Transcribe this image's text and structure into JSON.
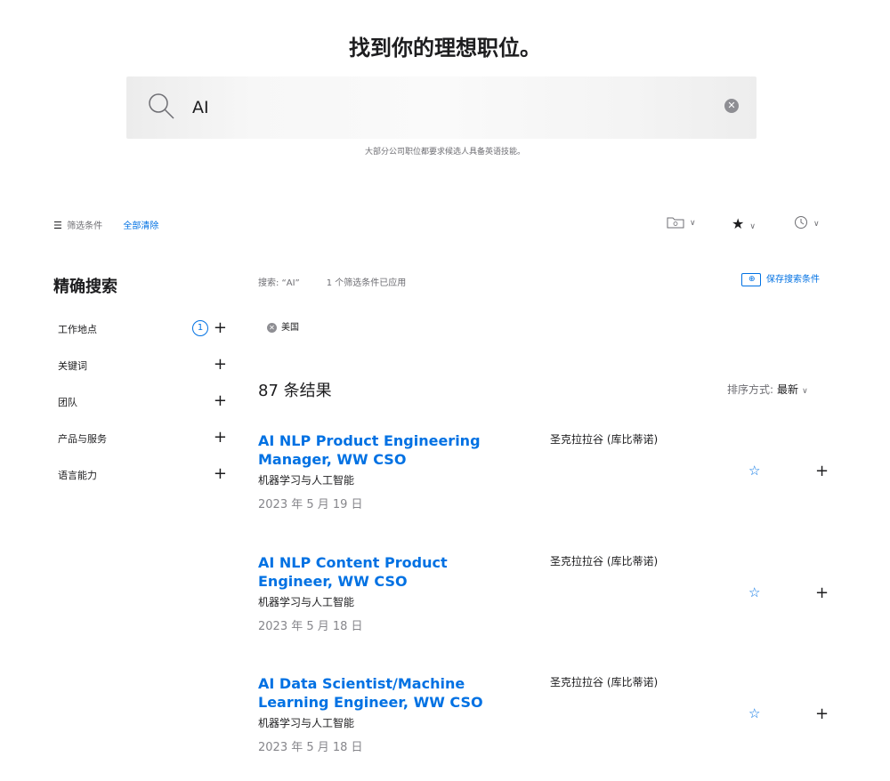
{
  "header": {
    "title": "找到你的理想职位。"
  },
  "search": {
    "value": "AI",
    "note": "大部分公司职位都要求候选人具备英语技能。"
  },
  "filter_bar": {
    "label": "筛选条件",
    "clear_all": "全部清除"
  },
  "sidebar": {
    "title": "精确搜索",
    "items": [
      {
        "label": "工作地点",
        "count": "1"
      },
      {
        "label": "关键词"
      },
      {
        "label": "团队"
      },
      {
        "label": "产品与服务"
      },
      {
        "label": "语言能力"
      }
    ]
  },
  "query": {
    "text": "搜索: “AI”",
    "applied": "1 个筛选条件已应用"
  },
  "save_search": {
    "label": "保存搜索条件"
  },
  "chip": {
    "label": "美国"
  },
  "results": {
    "count_label": "87 条结果"
  },
  "sort": {
    "label": "排序方式:",
    "value": "最新"
  },
  "jobs": [
    {
      "title": "AI NLP Product Engineering Manager, WW CSO",
      "location": "圣克拉拉谷 (库比蒂诺)",
      "team": "机器学习与人工智能",
      "date": "2023 年 5 月 19 日"
    },
    {
      "title": "AI NLP Content Product Engineer, WW CSO",
      "location": "圣克拉拉谷 (库比蒂诺)",
      "team": "机器学习与人工智能",
      "date": "2023 年 5 月 18 日"
    },
    {
      "title": "AI Data Scientist/Machine Learning Engineer, WW CSO",
      "location": "圣克拉拉谷 (库比蒂诺)",
      "team": "机器学习与人工智能",
      "date": "2023 年 5 月 18 日"
    }
  ],
  "icons": {
    "search": "magnifier-icon",
    "clear": "close-circle-icon",
    "filter": "list-icon",
    "folder": "folder-icon",
    "star": "star-icon",
    "history": "history-icon",
    "add": "plus-icon",
    "chevron": "chevron-down-icon"
  },
  "colors": {
    "accent": "#0071e3",
    "text": "#1d1d1f",
    "muted": "#86868b"
  }
}
